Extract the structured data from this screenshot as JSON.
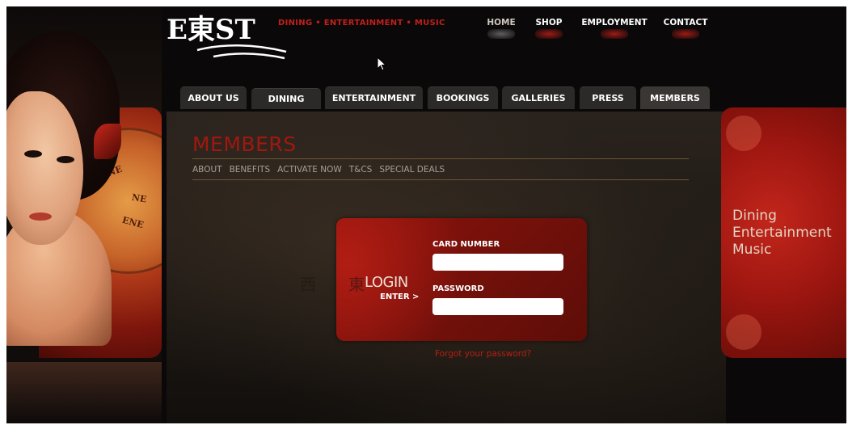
{
  "header": {
    "logo_text": "E東ST",
    "tagline": "DINING • ENTERTAINMENT • MUSIC",
    "top_nav": [
      {
        "label": "HOME"
      },
      {
        "label": "SHOP"
      },
      {
        "label": "EMPLOYMENT"
      },
      {
        "label": "CONTACT"
      }
    ]
  },
  "main_nav": [
    {
      "label": "ABOUT US"
    },
    {
      "label": "DINING"
    },
    {
      "label": "ENTERTAINMENT"
    },
    {
      "label": "BOOKINGS"
    },
    {
      "label": "GALLERIES"
    },
    {
      "label": "PRESS"
    },
    {
      "label": "MEMBERS"
    }
  ],
  "page": {
    "title": "MEMBERS",
    "sub_nav": [
      {
        "label": "ABOUT"
      },
      {
        "label": "BENEFITS"
      },
      {
        "label": "ACTIVATE NOW"
      },
      {
        "label": "T&CS"
      },
      {
        "label": "SPECIAL DEALS"
      }
    ]
  },
  "login": {
    "title": "LOGIN",
    "enter_label": "ENTER >",
    "card_number_label": "CARD NUMBER",
    "card_number_value": "",
    "password_label": "PASSWORD",
    "password_value": "",
    "forgot_link": "Forgot your password?",
    "kanji": [
      "西",
      "東"
    ]
  },
  "side": {
    "lines": [
      "Dining",
      "Entertainment",
      "Music"
    ]
  },
  "compass_labels": [
    "NNE",
    "NE",
    "ENE"
  ],
  "colors": {
    "accent_red": "#c1201b",
    "background": "#0a0808",
    "login_red": "#8c130c",
    "nav_tab": "#2c2a29"
  }
}
